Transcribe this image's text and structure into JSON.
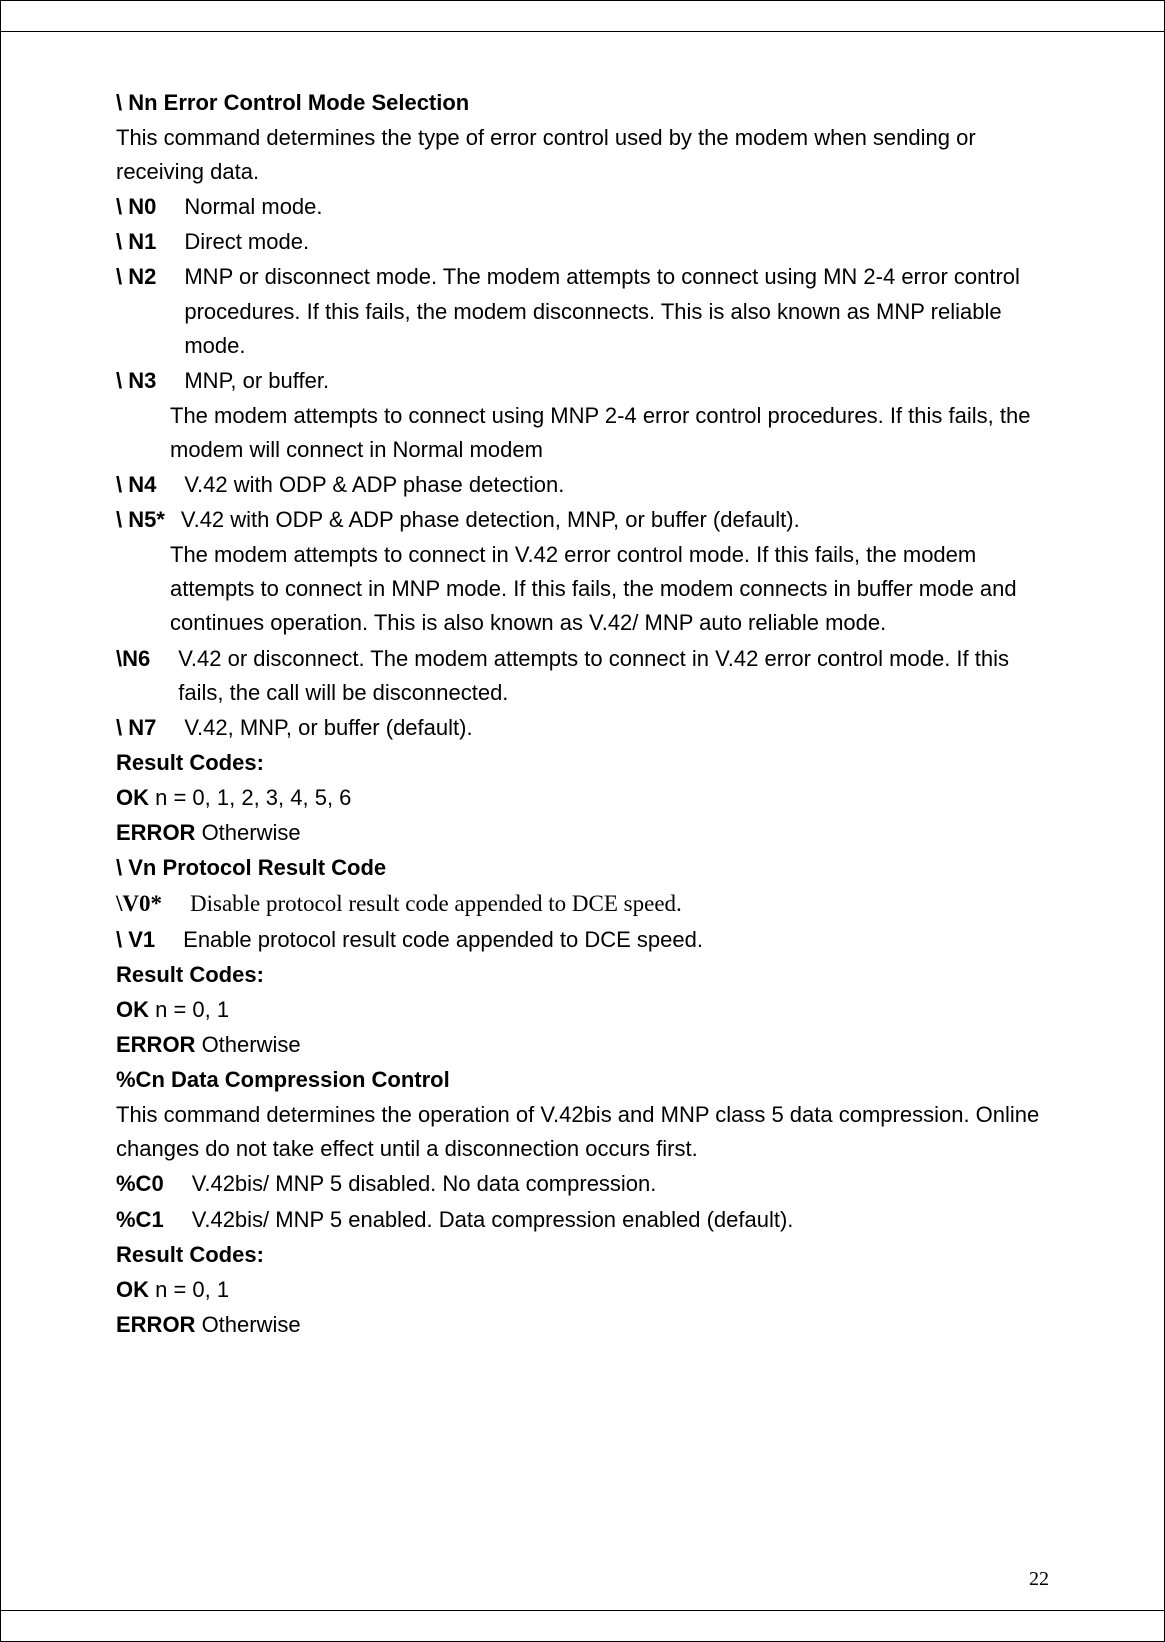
{
  "section1": {
    "title": "\\ Nn Error Control Mode Selection",
    "intro": "This command determines the type of error control used by the modem when sending or receiving data.",
    "items": [
      {
        "label": "\\ N0",
        "text": "Normal mode."
      },
      {
        "label": "\\ N1",
        "text": "Direct mode."
      },
      {
        "label": "\\ N2",
        "text": "MNP or disconnect mode. The modem attempts to connect using MN 2-4 error control procedures. If this fails, the modem disconnects. This is also known as MNP reliable mode."
      },
      {
        "label": "\\ N3",
        "text": "MNP, or buffer.",
        "extra": "The modem attempts to connect using MNP 2-4 error control procedures. If this fails, the modem will connect in Normal modem"
      },
      {
        "label": "\\ N4",
        "text": "V.42 with ODP & ADP phase detection."
      },
      {
        "label": "\\ N5*",
        "text": " V.42 with ODP & ADP phase detection, MNP, or buffer (default).",
        "extra": "The modem attempts to connect in V.42 error control mode. If this fails, the modem attempts to connect in MNP mode. If this fails, the modem connects in buffer mode and continues operation. This is also known as V.42/ MNP auto reliable mode."
      },
      {
        "label": "\\N6",
        "text": "V.42 or disconnect. The modem attempts to connect in V.42 error control mode. If this fails, the call will be disconnected."
      },
      {
        "label": "\\ N7",
        "text": "V.42, MNP, or buffer (default)."
      }
    ],
    "result_heading": "Result Codes:",
    "ok_label": "OK",
    "ok_text": " n = 0, 1, 2, 3, 4, 5, 6",
    "error_label": "ERROR",
    "error_text": " Otherwise"
  },
  "section2": {
    "title": "\\ Vn Protocol Result Code",
    "items": [
      {
        "label": "\\V0*",
        "text": "Disable protocol result code appended to DCE speed.",
        "serif": true
      },
      {
        "label": "\\ V1",
        "text": "Enable protocol result code appended to DCE speed."
      }
    ],
    "result_heading": "Result Codes:",
    "ok_label": "OK",
    "ok_text": " n = 0, 1",
    "error_label": "ERROR",
    "error_text": " Otherwise"
  },
  "section3": {
    "title": "%Cn Data Compression Control",
    "intro": "This command determines the operation of V.42bis and MNP class 5 data compression. Online changes do not take effect until a disconnection occurs first.",
    "items": [
      {
        "label": "%C0",
        "text": "V.42bis/ MNP 5 disabled. No data compression."
      },
      {
        "label": "%C1",
        "text": "V.42bis/ MNP 5 enabled. Data compression enabled (default)."
      }
    ],
    "result_heading": "Result Codes:",
    "ok_label": "OK",
    "ok_text": " n = 0, 1",
    "error_label": "ERROR",
    "error_text": " Otherwise"
  },
  "page_number": "22"
}
